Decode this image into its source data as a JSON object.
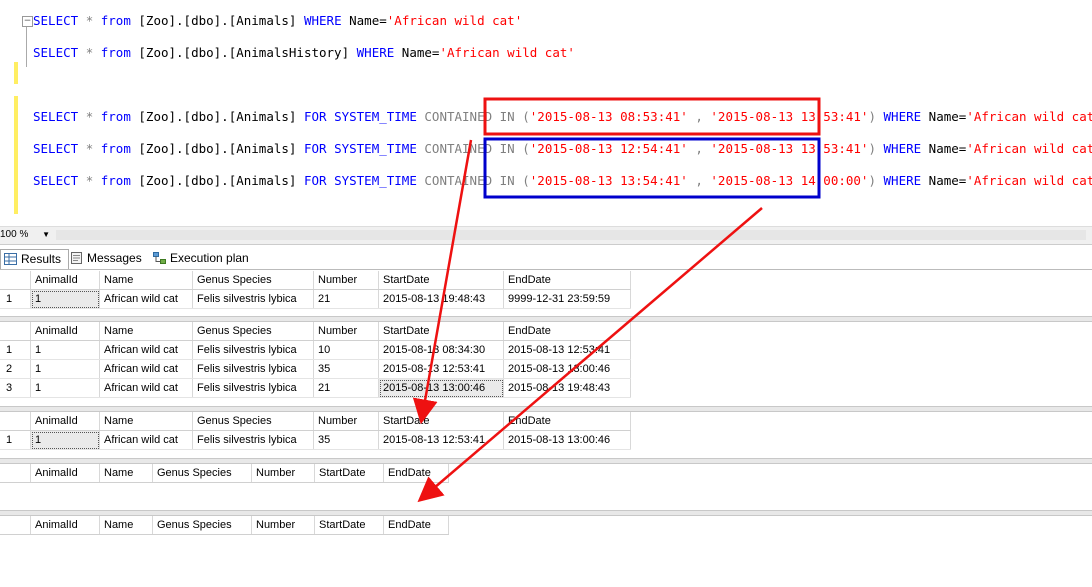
{
  "editor": {
    "lines": [
      {
        "parts": [
          [
            "kw",
            "SELECT "
          ],
          [
            "gray",
            "* "
          ],
          [
            "kw",
            "from "
          ],
          [
            "blk",
            "[Zoo].[dbo].[Animals] "
          ],
          [
            "kw",
            "WHERE "
          ],
          [
            "blk",
            "Name="
          ],
          [
            "str",
            "'African wild cat'"
          ]
        ]
      },
      {
        "parts": [
          [
            "kw",
            "SELECT "
          ],
          [
            "gray",
            "* "
          ],
          [
            "kw",
            "from "
          ],
          [
            "blk",
            "[Zoo].[dbo].[AnimalsHistory] "
          ],
          [
            "kw",
            "WHERE "
          ],
          [
            "blk",
            "Name="
          ],
          [
            "str",
            "'African wild cat'"
          ]
        ]
      },
      {
        "parts": [
          [
            "kw",
            "SELECT "
          ],
          [
            "gray",
            "* "
          ],
          [
            "kw",
            "from "
          ],
          [
            "blk",
            "[Zoo].[dbo].[Animals] "
          ],
          [
            "kw",
            "FOR SYSTEM_TIME "
          ],
          [
            "gray",
            "CONTAINED IN "
          ],
          [
            "gray",
            "("
          ],
          [
            "str",
            "'2015-08-13 08:53:41' "
          ],
          [
            "gray",
            ", "
          ],
          [
            "str",
            "'2015-08-13 13:53:41'"
          ],
          [
            "gray",
            ") "
          ],
          [
            "kw",
            "WHERE "
          ],
          [
            "blk",
            "Name="
          ],
          [
            "str",
            "'African wild cat'"
          ]
        ]
      },
      {
        "parts": [
          [
            "kw",
            "SELECT "
          ],
          [
            "gray",
            "* "
          ],
          [
            "kw",
            "from "
          ],
          [
            "blk",
            "[Zoo].[dbo].[Animals] "
          ],
          [
            "kw",
            "FOR SYSTEM_TIME "
          ],
          [
            "gray",
            "CONTAINED IN "
          ],
          [
            "gray",
            "("
          ],
          [
            "str",
            "'2015-08-13 12:54:41' "
          ],
          [
            "gray",
            ", "
          ],
          [
            "str",
            "'2015-08-13 13:53:41'"
          ],
          [
            "gray",
            ") "
          ],
          [
            "kw",
            "WHERE "
          ],
          [
            "blk",
            "Name="
          ],
          [
            "str",
            "'African wild cat'"
          ]
        ]
      },
      {
        "parts": [
          [
            "kw",
            "SELECT "
          ],
          [
            "gray",
            "* "
          ],
          [
            "kw",
            "from "
          ],
          [
            "blk",
            "[Zoo].[dbo].[Animals] "
          ],
          [
            "kw",
            "FOR SYSTEM_TIME "
          ],
          [
            "gray",
            "CONTAINED IN "
          ],
          [
            "gray",
            "("
          ],
          [
            "str",
            "'2015-08-13 13:54:41' "
          ],
          [
            "gray",
            ", "
          ],
          [
            "str",
            "'2015-08-13 14:00:00'"
          ],
          [
            "gray",
            ") "
          ],
          [
            "kw",
            "WHERE "
          ],
          [
            "blk",
            "Name="
          ],
          [
            "str",
            "'African wild cat'"
          ]
        ]
      }
    ]
  },
  "zoom": {
    "value": "100 %"
  },
  "tabs": [
    {
      "label": "Results",
      "icon": "grid-icon"
    },
    {
      "label": "Messages",
      "icon": "messages-icon"
    },
    {
      "label": "Execution plan",
      "icon": "execution-plan-icon"
    }
  ],
  "results": [
    {
      "columns": [
        "AnimalId",
        "Name",
        "Genus Species",
        "Number",
        "StartDate",
        "EndDate"
      ],
      "rows": [
        [
          "1",
          "1",
          "African wild cat",
          "Felis silvestris lybica",
          "21",
          "2015-08-13 19:48:43",
          "9999-12-31 23:59:59"
        ]
      ]
    },
    {
      "columns": [
        "AnimalId",
        "Name",
        "Genus Species",
        "Number",
        "StartDate",
        "EndDate"
      ],
      "rows": [
        [
          "1",
          "1",
          "African wild cat",
          "Felis silvestris lybica",
          "10",
          "2015-08-13 08:34:30",
          "2015-08-13 12:53:41"
        ],
        [
          "2",
          "1",
          "African wild cat",
          "Felis silvestris lybica",
          "35",
          "2015-08-13 12:53:41",
          "2015-08-13 13:00:46"
        ],
        [
          "3",
          "1",
          "African wild cat",
          "Felis silvestris lybica",
          "21",
          "2015-08-13 13:00:46",
          "2015-08-13 19:48:43"
        ]
      ]
    },
    {
      "columns": [
        "AnimalId",
        "Name",
        "Genus Species",
        "Number",
        "StartDate",
        "EndDate"
      ],
      "rows": [
        [
          "1",
          "1",
          "African wild cat",
          "Felis silvestris lybica",
          "35",
          "2015-08-13 12:53:41",
          "2015-08-13 13:00:46"
        ]
      ]
    },
    {
      "columns": [
        "AnimalId",
        "Name",
        "Genus Species",
        "Number",
        "StartDate",
        "EndDate"
      ],
      "rows": []
    },
    {
      "columns": [
        "AnimalId",
        "Name",
        "Genus Species",
        "Number",
        "StartDate",
        "EndDate"
      ],
      "rows": []
    }
  ],
  "colors": {
    "annotation_red": "#ee1111",
    "annotation_blue": "#0000cc",
    "keyword": "#0000ff",
    "string": "#ff0000"
  }
}
